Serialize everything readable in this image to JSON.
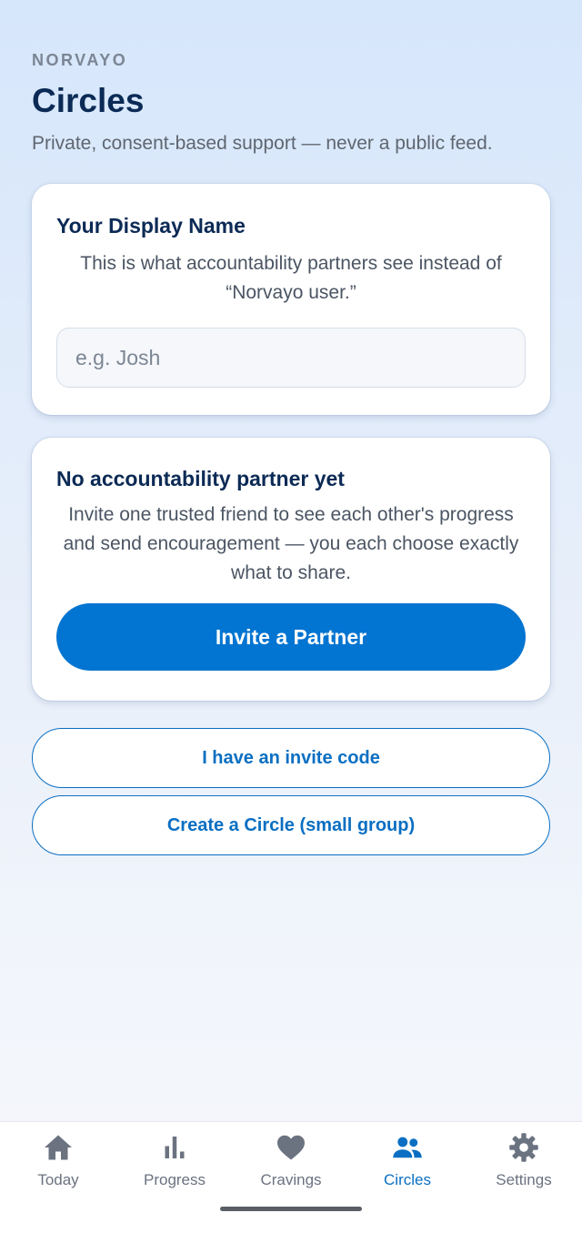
{
  "header": {
    "brand": "NORVAYO",
    "title": "Circles",
    "subtitle": "Private, consent-based support — never a public feed."
  },
  "display_name_card": {
    "title": "Your Display Name",
    "description": "This is what accountability partners see instead of “Norvayo user.”",
    "input_value": "",
    "input_placeholder": "e.g. Josh"
  },
  "partner_card": {
    "title": "No accountability partner yet",
    "description": "Invite one trusted friend to see each other's progress and send encouragement — you each choose exactly what to share.",
    "button_label": "Invite a Partner"
  },
  "actions": {
    "invite_code_label": "I have an invite code",
    "create_circle_label": "Create a Circle (small group)"
  },
  "tabbar": {
    "items": [
      {
        "label": "Today",
        "icon": "home-icon",
        "active": false
      },
      {
        "label": "Progress",
        "icon": "bar-chart-icon",
        "active": false
      },
      {
        "label": "Cravings",
        "icon": "heart-icon",
        "active": false
      },
      {
        "label": "Circles",
        "icon": "people-icon",
        "active": true
      },
      {
        "label": "Settings",
        "icon": "gear-icon",
        "active": false
      }
    ]
  },
  "colors": {
    "accent": "#0274d1",
    "heading": "#0b2a55",
    "inactive_tab": "#6b7280",
    "active_tab": "#0a6fc2"
  }
}
